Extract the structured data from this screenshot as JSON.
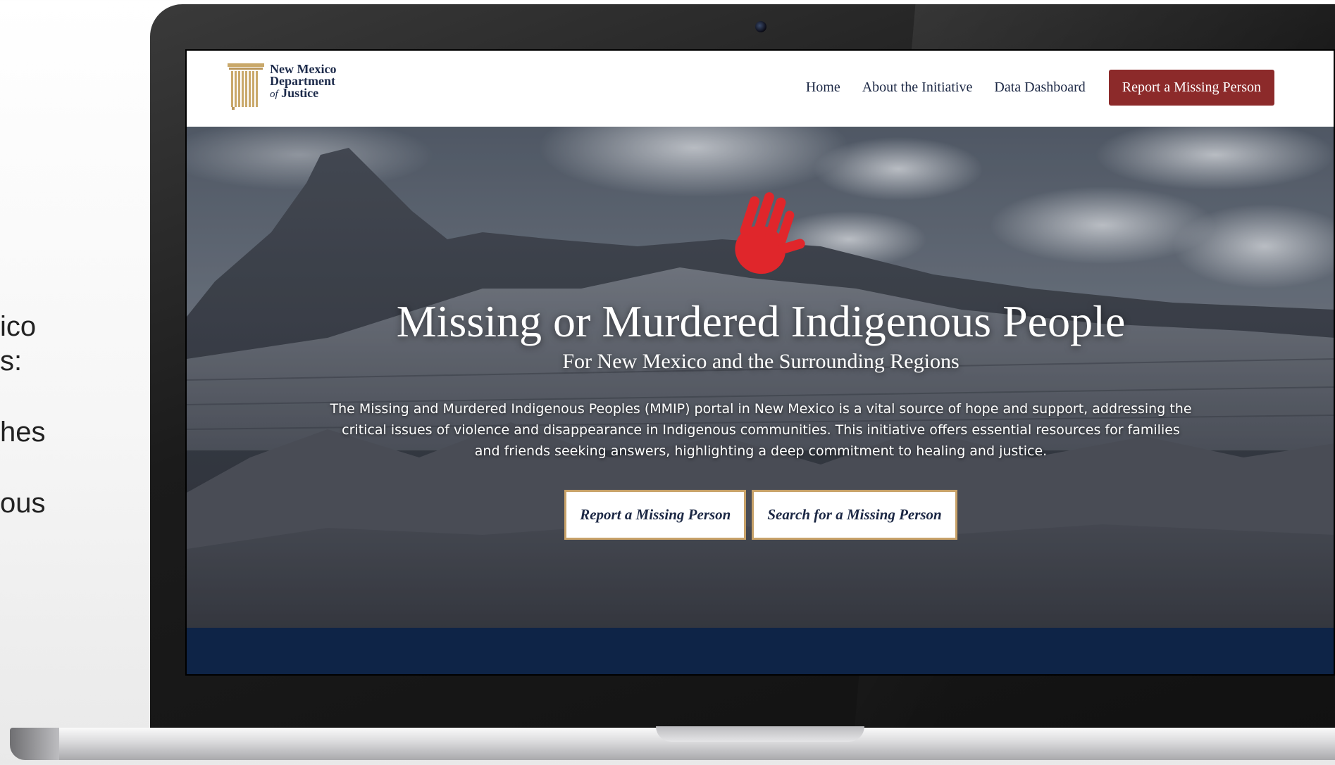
{
  "side_text": {
    "line1": "ico",
    "line2": "s:",
    "line3": "hes",
    "line4": "ous"
  },
  "header": {
    "logo": {
      "line1": "New Mexico",
      "line2": "Department",
      "line3_prefix": "of",
      "line3": "Justice"
    },
    "nav": [
      {
        "label": "Home"
      },
      {
        "label": "About the Initiative"
      },
      {
        "label": "Data Dashboard"
      }
    ],
    "cta_label": "Report a Missing Person"
  },
  "hero": {
    "title": "Missing or Murdered Indigenous People",
    "subtitle": "For New Mexico and the Surrounding Regions",
    "body": "The Missing and Murdered Indigenous Peoples (MMIP) portal in New Mexico is a vital source of hope and support, addressing the critical issues of violence and disappearance in Indigenous communities. This initiative offers essential resources for families and friends seeking answers, highlighting a deep commitment to healing and justice.",
    "buttons": [
      {
        "label": "Report a Missing Person"
      },
      {
        "label": "Search for a Missing Person"
      }
    ]
  },
  "colors": {
    "primary_navy": "#1b2744",
    "cta_red": "#8c2a2a",
    "button_border_gold": "#c8a269",
    "hand_red": "#e0262b",
    "footer_band": "#0e2447"
  },
  "icons": {
    "logo": "pillars-icon",
    "hero": "red-handprint-icon"
  }
}
